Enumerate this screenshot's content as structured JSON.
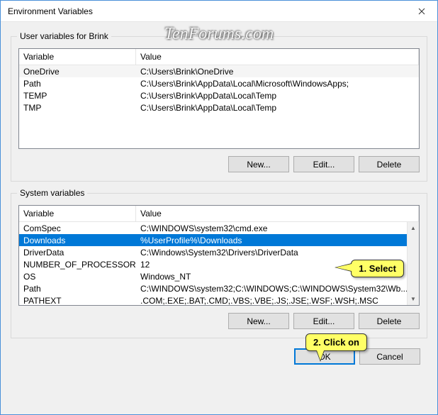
{
  "title": "Environment Variables",
  "watermark": "TenForums.com",
  "user_section": {
    "title": "User variables for Brink",
    "headers": {
      "variable": "Variable",
      "value": "Value"
    },
    "rows": [
      {
        "variable": "OneDrive",
        "value": "C:\\Users\\Brink\\OneDrive",
        "highlight": true
      },
      {
        "variable": "Path",
        "value": "C:\\Users\\Brink\\AppData\\Local\\Microsoft\\WindowsApps;"
      },
      {
        "variable": "TEMP",
        "value": "C:\\Users\\Brink\\AppData\\Local\\Temp"
      },
      {
        "variable": "TMP",
        "value": "C:\\Users\\Brink\\AppData\\Local\\Temp"
      }
    ],
    "buttons": {
      "new": "New...",
      "edit": "Edit...",
      "delete": "Delete"
    }
  },
  "system_section": {
    "title": "System variables",
    "headers": {
      "variable": "Variable",
      "value": "Value"
    },
    "rows": [
      {
        "variable": "ComSpec",
        "value": "C:\\WINDOWS\\system32\\cmd.exe"
      },
      {
        "variable": "Downloads",
        "value": "%UserProfile%\\Downloads",
        "selected": true
      },
      {
        "variable": "DriverData",
        "value": "C:\\Windows\\System32\\Drivers\\DriverData"
      },
      {
        "variable": "NUMBER_OF_PROCESSORS",
        "value": "12"
      },
      {
        "variable": "OS",
        "value": "Windows_NT"
      },
      {
        "variable": "Path",
        "value": "C:\\WINDOWS\\system32;C:\\WINDOWS;C:\\WINDOWS\\System32\\Wb..."
      },
      {
        "variable": "PATHEXT",
        "value": ".COM;.EXE;.BAT;.CMD;.VBS;.VBE;.JS;.JSE;.WSF;.WSH;.MSC"
      }
    ],
    "buttons": {
      "new": "New...",
      "edit": "Edit...",
      "delete": "Delete"
    }
  },
  "dialog_buttons": {
    "ok": "OK",
    "cancel": "Cancel"
  },
  "callouts": {
    "select": "1. Select",
    "click": "2. Click on"
  }
}
